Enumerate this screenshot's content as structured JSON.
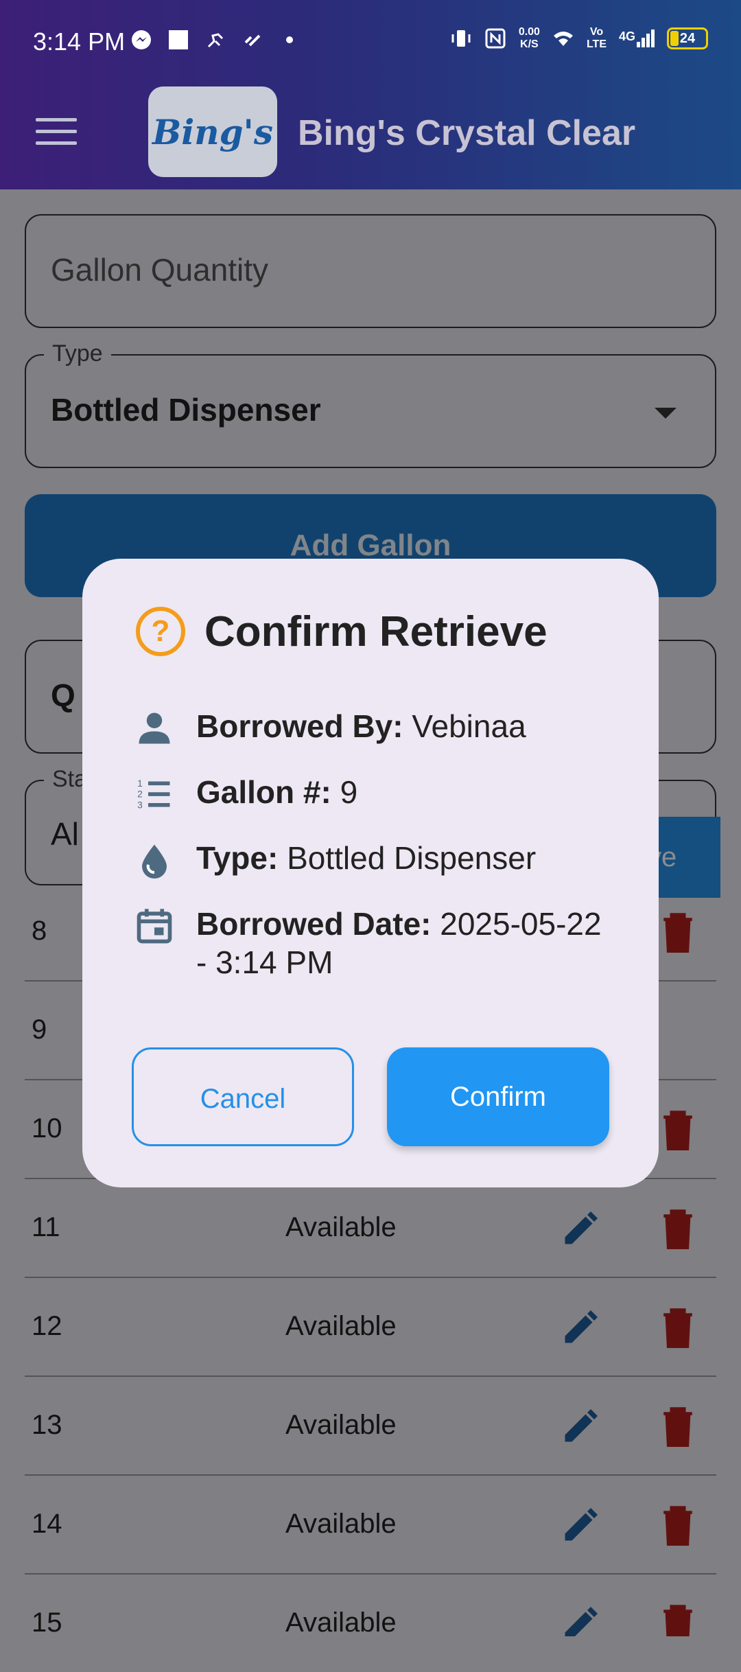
{
  "status_bar": {
    "time": "3:14 PM",
    "net_speed": "0.00\nK/S",
    "volte": "Vo\nLTE",
    "network": "4G",
    "battery": "24"
  },
  "app_bar": {
    "logo_text": "Bing's",
    "title": "Bing's Crystal Clear"
  },
  "form": {
    "gallon_quantity_placeholder": "Gallon Quantity",
    "type_label": "Type",
    "type_value": "Bottled Dispenser",
    "add_button": "Add Gallon",
    "search_partial": "Q",
    "status_label_partial": "Sta",
    "status_value_partial": "Al"
  },
  "table": {
    "rows": [
      {
        "num": "8",
        "status": ""
      },
      {
        "num": "9",
        "status": ""
      },
      {
        "num": "10",
        "status": ""
      },
      {
        "num": "11",
        "status": "Available"
      },
      {
        "num": "12",
        "status": "Available"
      },
      {
        "num": "13",
        "status": "Available"
      },
      {
        "num": "14",
        "status": "Available"
      },
      {
        "num": "15",
        "status": "Available"
      }
    ],
    "retrieve_partial": "ve"
  },
  "dialog": {
    "title": "Confirm Retrieve",
    "borrowed_by_label": "Borrowed By:",
    "borrowed_by_value": "Vebinaa",
    "gallon_label": "Gallon #:",
    "gallon_value": "9",
    "type_label": "Type:",
    "type_value": "Bottled Dispenser",
    "date_label": "Borrowed Date:",
    "date_value": "2025-05-22 - 3:14 PM",
    "cancel": "Cancel",
    "confirm": "Confirm"
  },
  "colors": {
    "primary": "#2196f3",
    "warning": "#f59c1a",
    "delete": "#b0201c"
  }
}
